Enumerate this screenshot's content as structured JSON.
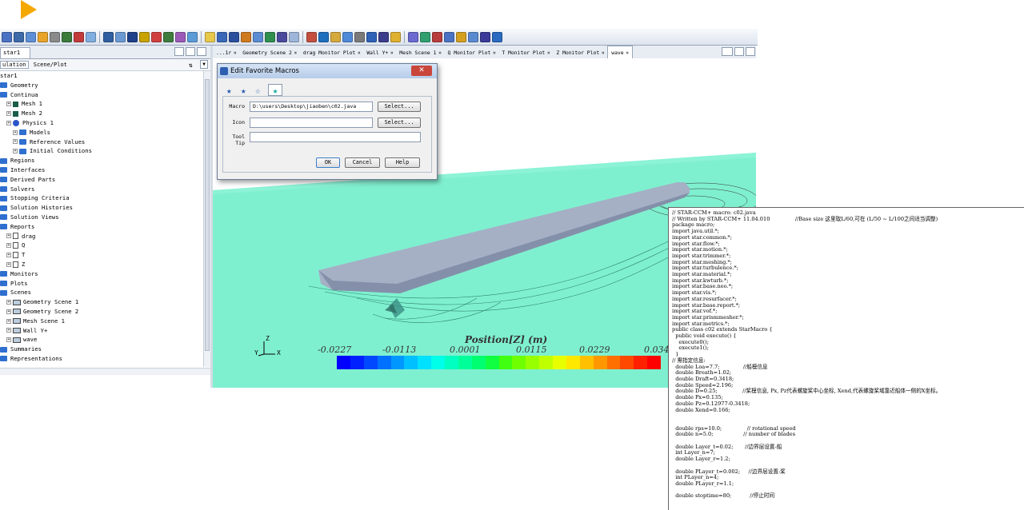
{
  "toolbar_colors": [
    "#4a72c4",
    "#3d6aa8",
    "#5c8fd6",
    "#e9a42b",
    "#8a8a8a",
    "#3a7a3a",
    "#c23b3b",
    "#7faee0",
    "#2f5fa0",
    "#6b9ad3",
    "#1e3f8a",
    "#c8a200",
    "#d04040",
    "#3e7c3e",
    "#9c5ab8",
    "#5a9bd8",
    "#e8c84a",
    "#3a68b8",
    "#2a4f9c",
    "#cf7a1f",
    "#5b8bd2",
    "#2f8f4f",
    "#4a4a9c",
    "#9db5d8",
    "#c44f3f",
    "#1f6fbf",
    "#d5a93b",
    "#4f8ad8",
    "#7a7a7a",
    "#2d62b7",
    "#3c3c8c",
    "#e0b030",
    "#6a6ad0",
    "#2f9f6f",
    "#b83c3c",
    "#4a72c4",
    "#d4a020",
    "#5a8ad0",
    "#3a3a9a",
    "#2a6ac0"
  ],
  "left_panel": {
    "tab_sim": "star1",
    "tab_scene": "ulation",
    "tab_sceneplot": "Scene/Plot",
    "tree": [
      {
        "label": "star1",
        "icon": "none",
        "indent": 0
      },
      {
        "label": "Geometry",
        "icon": "folder",
        "indent": 0
      },
      {
        "label": "Continua",
        "icon": "folder",
        "indent": 0
      },
      {
        "label": "Mesh 1",
        "icon": "mesh",
        "indent": 1
      },
      {
        "label": "Mesh 2",
        "icon": "mesh",
        "indent": 1
      },
      {
        "label": "Physics 1",
        "icon": "physics",
        "indent": 1
      },
      {
        "label": "Models",
        "icon": "folder",
        "indent": 2
      },
      {
        "label": "Reference Values",
        "icon": "folder",
        "indent": 2
      },
      {
        "label": "Initial Conditions",
        "icon": "folder",
        "indent": 2
      },
      {
        "label": "Regions",
        "icon": "folder",
        "indent": 0
      },
      {
        "label": "Interfaces",
        "icon": "folder",
        "indent": 0
      },
      {
        "label": "Derived Parts",
        "icon": "folder",
        "indent": 0
      },
      {
        "label": "Solvers",
        "icon": "folder",
        "indent": 0
      },
      {
        "label": "Stopping Criteria",
        "icon": "folder",
        "indent": 0
      },
      {
        "label": "Solution Histories",
        "icon": "folder",
        "indent": 0
      },
      {
        "label": "Solution Views",
        "icon": "folder",
        "indent": 0
      },
      {
        "label": "Reports",
        "icon": "folder",
        "indent": 0
      },
      {
        "label": "drag",
        "icon": "doc",
        "indent": 1
      },
      {
        "label": "Q",
        "icon": "doc",
        "indent": 1
      },
      {
        "label": "T",
        "icon": "doc",
        "indent": 1
      },
      {
        "label": "Z",
        "icon": "doc",
        "indent": 1
      },
      {
        "label": "Monitors",
        "icon": "folder",
        "indent": 0
      },
      {
        "label": "Plots",
        "icon": "folder",
        "indent": 0
      },
      {
        "label": "Scenes",
        "icon": "folder",
        "indent": 0
      },
      {
        "label": "Geometry Scene 1",
        "icon": "scene",
        "indent": 1
      },
      {
        "label": "Geometry Scene 2",
        "icon": "scene",
        "indent": 1
      },
      {
        "label": "Mesh Scene 1",
        "icon": "scene",
        "indent": 1
      },
      {
        "label": "Wall Y+",
        "icon": "scene",
        "indent": 1
      },
      {
        "label": "wave",
        "icon": "scene",
        "indent": 1
      },
      {
        "label": "Summaries",
        "icon": "folder",
        "indent": 0
      },
      {
        "label": "Representations",
        "icon": "folder",
        "indent": 0
      }
    ]
  },
  "view_tabs": [
    "...1r",
    "Geometry Scene 2",
    "drag Monitor Plot",
    "Wall Y+",
    "Mesh Scene 1",
    "Q Monitor Plot",
    "T Monitor Plot",
    "Z Monitor Plot",
    "wave"
  ],
  "dialog": {
    "title": "Edit Favorite Macros",
    "macro_label": "Macro",
    "macro_value": "D:\\users\\Desktop\\jiaoben\\c02.java",
    "icon_label": "Icon",
    "icon_value": "",
    "tooltip_label": "Tool Tip",
    "tooltip_value": "",
    "select_label": "Select...",
    "ok_label": "OK",
    "cancel_label": "Cancel",
    "help_label": "Help"
  },
  "colorbar": {
    "title": "Position[Z] (m)",
    "ticks": [
      "-0.0227",
      "-0.0113",
      "0.0001",
      "0.0115",
      "0.0229",
      "0.034"
    ],
    "colors": [
      "#0000ff",
      "#0020ff",
      "#0048ff",
      "#0070ff",
      "#0098ff",
      "#00c0ff",
      "#00e0ff",
      "#00ffe8",
      "#00ffc0",
      "#00ff98",
      "#00ff70",
      "#10ff40",
      "#40ff10",
      "#70ff00",
      "#98ff00",
      "#c0ff00",
      "#e8ff00",
      "#ffe800",
      "#ffc000",
      "#ff9800",
      "#ff7000",
      "#ff4800",
      "#ff2000",
      "#ff0000"
    ]
  },
  "axes": {
    "z": "Z",
    "y": "Y",
    "x": "X"
  },
  "code_lines": [
    "// STAR-CCM+ macro: c02.java",
    "// Written by STAR-CCM+ 11.04.010               //Base size 这里取L/60,可在 (L/50 ~ L/100之间适当调整)",
    "package macro;",
    "import java.util.*;",
    "import star.common.*;",
    "import star.flow.*;",
    "import star.motion.*;",
    "import star.trimmer.*;",
    "import star.meshing.*;",
    "import star.turbulence.*;",
    "import star.material.*;",
    "import star.kwturb.*;",
    "import star.base.neo.*;",
    "import star.vis.*;",
    "import star.resurfacer.*;",
    "import star.base.report.*;",
    "import star.vof.*;",
    "import star.prismmesher.*;",
    "import star.metrics.*;",
    "public class c02 extends StarMacro {",
    "  public void execute() {",
    "    execute0();",
    "    execute1();",
    "  }",
    "// 需指定信息:",
    "  double Loa=7.7;              //船模信息",
    "  double Breath=1.02;",
    "  double Draft=0.3418;",
    "  double Speed=2.196;",
    "  double D=0.25;               //桨模信息, Px, Pz代表螺旋桨中心坐标, Xend,代表螺旋桨域靠近船体一侧的X坐标。",
    "  double Px=0.135;",
    "  double Pz=0.12977-0.3418;",
    "  double Xend=0.166;",
    "",
    "",
    "  double rps=10.0;               // rotational speed",
    "  double n=5.0;                  // number of blades",
    "",
    "  double Layer_t=0.02;       //边界层设置-船",
    "  int Layer_n=7;",
    "  double Layer_r=1.2;",
    "",
    "  double PLayer_t=0.002;     //边界层设置-桨",
    "  int PLayer_n=4;",
    "  double PLayer_r=1.1;",
    "",
    "  double stoptime=80;           //停止时间"
  ]
}
